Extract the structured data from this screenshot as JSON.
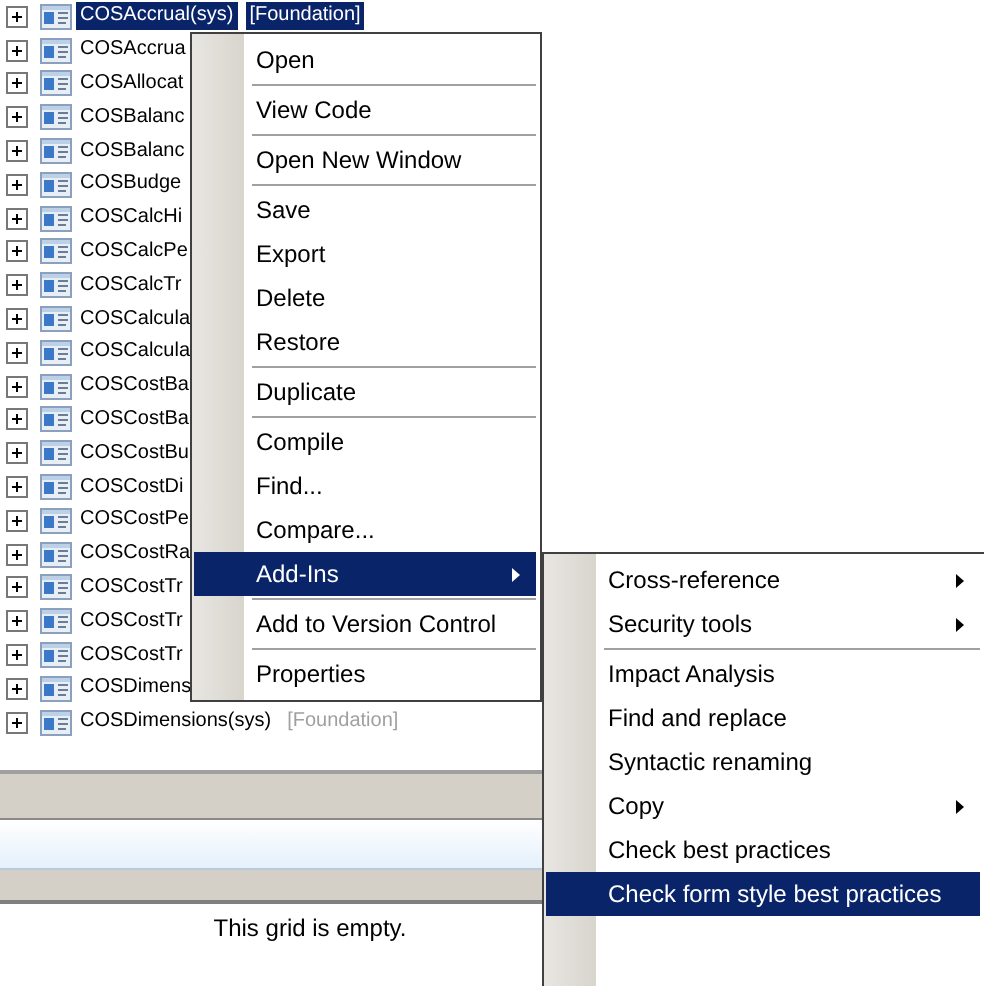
{
  "tree": {
    "rows": [
      {
        "name": "COSAccrual(sys)",
        "layer": "[Foundation]",
        "selected": true
      },
      {
        "name": "COSAccrua",
        "selected": false
      },
      {
        "name": "COSAllocat",
        "selected": false
      },
      {
        "name": "COSBalanc",
        "selected": false
      },
      {
        "name": "COSBalanc",
        "selected": false
      },
      {
        "name": "COSBudge",
        "selected": false
      },
      {
        "name": "COSCalcHi",
        "selected": false
      },
      {
        "name": "COSCalcPe",
        "selected": false
      },
      {
        "name": "COSCalcTr",
        "selected": false
      },
      {
        "name": "COSCalcula",
        "selected": false
      },
      {
        "name": "COSCalcula",
        "selected": false
      },
      {
        "name": "COSCostBa",
        "selected": false
      },
      {
        "name": "COSCostBa",
        "selected": false
      },
      {
        "name": "COSCostBu",
        "selected": false
      },
      {
        "name": "COSCostDi",
        "selected": false
      },
      {
        "name": "COSCostPe",
        "selected": false
      },
      {
        "name": "COSCostRa",
        "selected": false
      },
      {
        "name": "COSCostTr",
        "selected": false
      },
      {
        "name": "COSCostTr",
        "selected": false
      },
      {
        "name": "COSCostTr",
        "selected": false
      },
      {
        "name": "COSDimens",
        "selected": false
      },
      {
        "name": "COSDimensions(sys)",
        "layer": "[Foundation]",
        "selected": false
      }
    ]
  },
  "grid": {
    "empty_message": "This grid is empty."
  },
  "context_menu": {
    "items": [
      {
        "label": "Open",
        "selected": false,
        "separator_after": true
      },
      {
        "label": "View Code",
        "selected": false,
        "separator_after": true
      },
      {
        "label": "Open New Window",
        "selected": false,
        "separator_after": true
      },
      {
        "label": "Save",
        "selected": false
      },
      {
        "label": "Export",
        "selected": false
      },
      {
        "label": "Delete",
        "selected": false
      },
      {
        "label": "Restore",
        "selected": false,
        "separator_after": true
      },
      {
        "label": "Duplicate",
        "selected": false,
        "separator_after": true
      },
      {
        "label": "Compile",
        "selected": false
      },
      {
        "label": "Find...",
        "selected": false
      },
      {
        "label": "Compare...",
        "selected": false
      },
      {
        "label": "Add-Ins",
        "selected": true,
        "submenu": true,
        "separator_after": true
      },
      {
        "label": "Add to Version Control",
        "selected": false,
        "separator_after": true
      },
      {
        "label": "Properties",
        "selected": false
      }
    ]
  },
  "submenu": {
    "items": [
      {
        "label": "Cross-reference",
        "selected": false,
        "submenu": true
      },
      {
        "label": "Security tools",
        "selected": false,
        "submenu": true,
        "separator_after": true
      },
      {
        "label": "Impact Analysis",
        "selected": false
      },
      {
        "label": "Find and replace",
        "selected": false
      },
      {
        "label": "Syntactic renaming",
        "selected": false
      },
      {
        "label": "Copy",
        "selected": false,
        "submenu": true
      },
      {
        "label": "Check best practices",
        "selected": false
      },
      {
        "label": "Check form style best practices",
        "selected": true
      }
    ]
  }
}
